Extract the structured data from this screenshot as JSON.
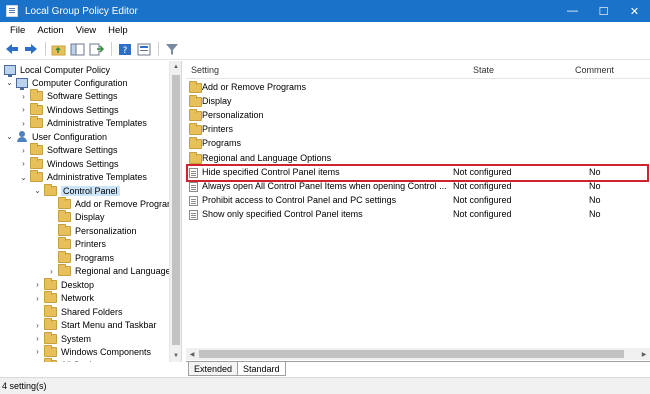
{
  "window": {
    "title": "Local Group Policy Editor",
    "minimize": "—",
    "maximize": "☐",
    "close": "✕"
  },
  "menu": [
    "File",
    "Action",
    "View",
    "Help"
  ],
  "toolbar": {
    "icons": [
      "back-icon",
      "forward-icon",
      "up-folder-icon",
      "show-hide-tree-icon",
      "export-list-icon",
      "help-icon",
      "properties-icon",
      "filter-icon"
    ]
  },
  "tree": [
    {
      "label": "Local Computer Policy",
      "icon": "computer",
      "expander": "",
      "level": 0
    },
    {
      "label": "Computer Configuration",
      "icon": "computer",
      "expander": "v",
      "level": 1
    },
    {
      "label": "Software Settings",
      "icon": "folder",
      "expander": ">",
      "level": 2
    },
    {
      "label": "Windows Settings",
      "icon": "folder",
      "expander": ">",
      "level": 2
    },
    {
      "label": "Administrative Templates",
      "icon": "folder",
      "expander": ">",
      "level": 2
    },
    {
      "label": "User Configuration",
      "icon": "user",
      "expander": "v",
      "level": 1
    },
    {
      "label": "Software Settings",
      "icon": "folder",
      "expander": ">",
      "level": 2
    },
    {
      "label": "Windows Settings",
      "icon": "folder",
      "expander": ">",
      "level": 2
    },
    {
      "label": "Administrative Templates",
      "icon": "folder",
      "expander": "v",
      "level": 2
    },
    {
      "label": "Control Panel",
      "icon": "folder",
      "expander": "v",
      "level": 3,
      "selected": true
    },
    {
      "label": "Add or Remove Programs",
      "icon": "folder",
      "expander": "",
      "level": 4
    },
    {
      "label": "Display",
      "icon": "folder",
      "expander": "",
      "level": 4
    },
    {
      "label": "Personalization",
      "icon": "folder",
      "expander": "",
      "level": 4
    },
    {
      "label": "Printers",
      "icon": "folder",
      "expander": "",
      "level": 4
    },
    {
      "label": "Programs",
      "icon": "folder",
      "expander": "",
      "level": 4
    },
    {
      "label": "Regional and Language Options",
      "icon": "folder",
      "expander": ">",
      "level": 4
    },
    {
      "label": "Desktop",
      "icon": "folder",
      "expander": ">",
      "level": 3
    },
    {
      "label": "Network",
      "icon": "folder",
      "expander": ">",
      "level": 3
    },
    {
      "label": "Shared Folders",
      "icon": "folder",
      "expander": "",
      "level": 3
    },
    {
      "label": "Start Menu and Taskbar",
      "icon": "folder",
      "expander": ">",
      "level": 3
    },
    {
      "label": "System",
      "icon": "folder",
      "expander": ">",
      "level": 3
    },
    {
      "label": "Windows Components",
      "icon": "folder",
      "expander": ">",
      "level": 3
    },
    {
      "label": "All Settings",
      "icon": "folder",
      "expander": "",
      "level": 3
    }
  ],
  "list": {
    "columns": {
      "setting": "Setting",
      "state": "State",
      "comment": "Comment"
    },
    "folders": [
      "Add or Remove Programs",
      "Display",
      "Personalization",
      "Printers",
      "Programs",
      "Regional and Language Options"
    ],
    "settings": [
      {
        "name": "Hide specified Control Panel items",
        "state": "Not configured",
        "comment": "No",
        "highlighted": true
      },
      {
        "name": "Always open All Control Panel Items when opening Control ...",
        "state": "Not configured",
        "comment": "No"
      },
      {
        "name": "Prohibit access to Control Panel and PC settings",
        "state": "Not configured",
        "comment": "No"
      },
      {
        "name": "Show only specified Control Panel items",
        "state": "Not configured",
        "comment": "No"
      }
    ]
  },
  "tabs": [
    "Extended",
    "Standard"
  ],
  "active_tab": "Standard",
  "status": "4 setting(s)",
  "colors": {
    "titlebar": "#1a73c9",
    "selection": "#cce4f7",
    "highlight_border": "#d0232f",
    "folder": "#e8c05a"
  }
}
